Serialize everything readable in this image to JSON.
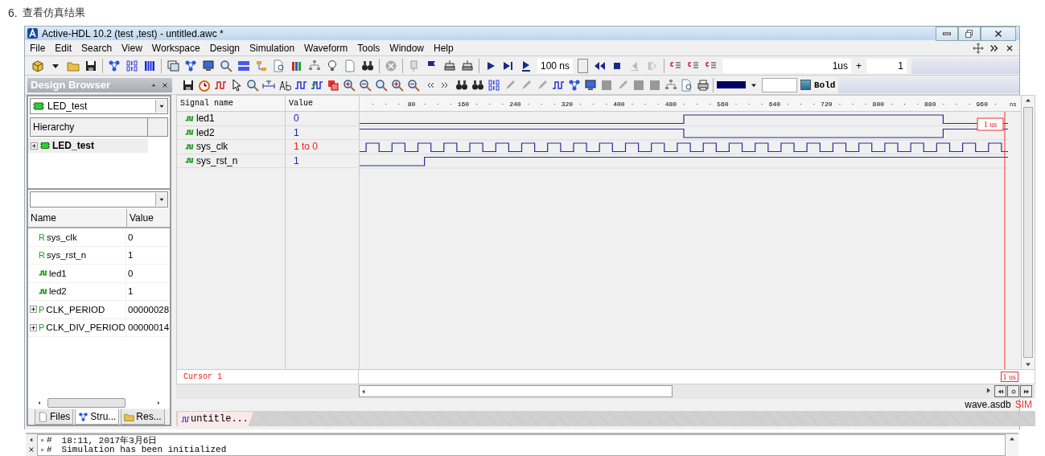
{
  "heading": {
    "number": "6.",
    "text": "查看仿真结果"
  },
  "window": {
    "title": "Active-HDL 10.2 (test ,test) - untitled.awc *"
  },
  "menu": [
    {
      "label": "File"
    },
    {
      "label": "Edit"
    },
    {
      "label": "Search"
    },
    {
      "label": "View"
    },
    {
      "label": "Workspace"
    },
    {
      "label": "Design"
    },
    {
      "label": "Simulation"
    },
    {
      "label": "Waveform"
    },
    {
      "label": "Tools"
    },
    {
      "label": "Window"
    },
    {
      "label": "Help"
    }
  ],
  "toolbar": {
    "step": "100 ns",
    "time": "1us",
    "plus": "+",
    "count": "1"
  },
  "format_bar": {
    "bold": {
      "label": "Bold",
      "checked": false
    }
  },
  "design_browser": {
    "title": "Design Browser",
    "design": "LED_test",
    "hierarchy_header": "Hierarchy",
    "tree": [
      {
        "label": "LED_test",
        "expanded": false
      }
    ],
    "columns": [
      "Name",
      "Value"
    ],
    "rows": [
      {
        "kind": "port",
        "mark": "R",
        "name": "sys_clk",
        "value": "0"
      },
      {
        "kind": "port",
        "mark": "R",
        "name": "sys_rst_n",
        "value": "1"
      },
      {
        "kind": "signal",
        "name": "led1",
        "value": "0"
      },
      {
        "kind": "signal",
        "name": "led2",
        "value": "1"
      },
      {
        "kind": "parameter",
        "mark": "P",
        "name": "CLK_PERIOD",
        "value": "00000028",
        "expanded": false
      },
      {
        "kind": "parameter",
        "mark": "P",
        "name": "CLK_DIV_PERIOD",
        "value": "00000014",
        "expanded": false
      }
    ],
    "tabs": [
      {
        "label": "Files",
        "selected": false
      },
      {
        "label": "Stru...",
        "selected": true
      },
      {
        "label": "Res...",
        "selected": false
      }
    ]
  },
  "waveform": {
    "columns": [
      "Signal name",
      "Value"
    ],
    "signals": [
      {
        "name": "led1",
        "value": "0",
        "changing": false
      },
      {
        "name": "led2",
        "value": "1",
        "changing": false
      },
      {
        "name": "sys_clk",
        "value": "1 to 0",
        "changing": true
      },
      {
        "name": "sys_rst_n",
        "value": "1",
        "changing": false
      }
    ],
    "ticks": [
      "80",
      "160",
      "240",
      "320",
      "400",
      "480",
      "560",
      "640",
      "720",
      "800",
      "880",
      "960"
    ],
    "unit": "ns",
    "cursor": {
      "label": "Cursor 1",
      "top_time": "1 us",
      "bottom_time": "1 us"
    },
    "file": "wave.asdb",
    "mode": "SIM",
    "tabs": [
      {
        "label": "untitle...",
        "selected": true
      }
    ]
  },
  "console": {
    "lines": [
      {
        "mark": "#",
        "text": "18:11, 2017年3月6日"
      },
      {
        "mark": "#",
        "text": "Simulation has been initialized"
      }
    ]
  }
}
